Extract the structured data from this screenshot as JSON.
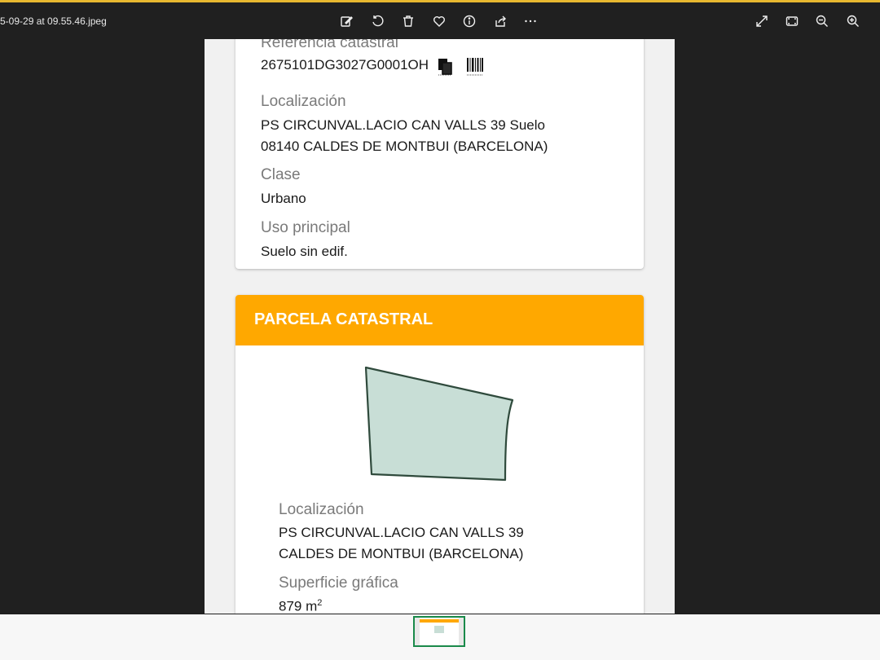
{
  "window": {
    "filename": "5-09-29 at 09.55.46.jpeg",
    "accent_color": "#e8b830",
    "toolbar_icons": [
      "edit-icon",
      "rotate-icon",
      "delete-icon",
      "favorite-icon",
      "info-icon",
      "share-icon",
      "more-icon"
    ],
    "right_icons": [
      "expand-icon",
      "fit-icon",
      "zoom-out-icon",
      "zoom-in-icon"
    ]
  },
  "card1": {
    "ref_label": "Referencia catastral",
    "ref_value": "2675101DG3027G0001OH",
    "loc_label": "Localización",
    "loc_line1": "PS CIRCUNVAL.LACIO CAN VALLS 39 Suelo",
    "loc_line2": "08140 CALDES DE MONTBUI (BARCELONA)",
    "clase_label": "Clase",
    "clase_value": "Urbano",
    "uso_label": "Uso principal",
    "uso_value": "Suelo sin edif."
  },
  "card2": {
    "title": "PARCELA CATASTRAL",
    "header_color": "#ffa800",
    "parcel_fill": "#c8ded6",
    "loc_label": "Localización",
    "loc_line1": "PS CIRCUNVAL.LACIO CAN VALLS 39",
    "loc_line2": "CALDES DE MONTBUI (BARCELONA)",
    "sup_label": "Superficie gráfica",
    "sup_value": "879 m",
    "sup_unit_sup": "2"
  }
}
